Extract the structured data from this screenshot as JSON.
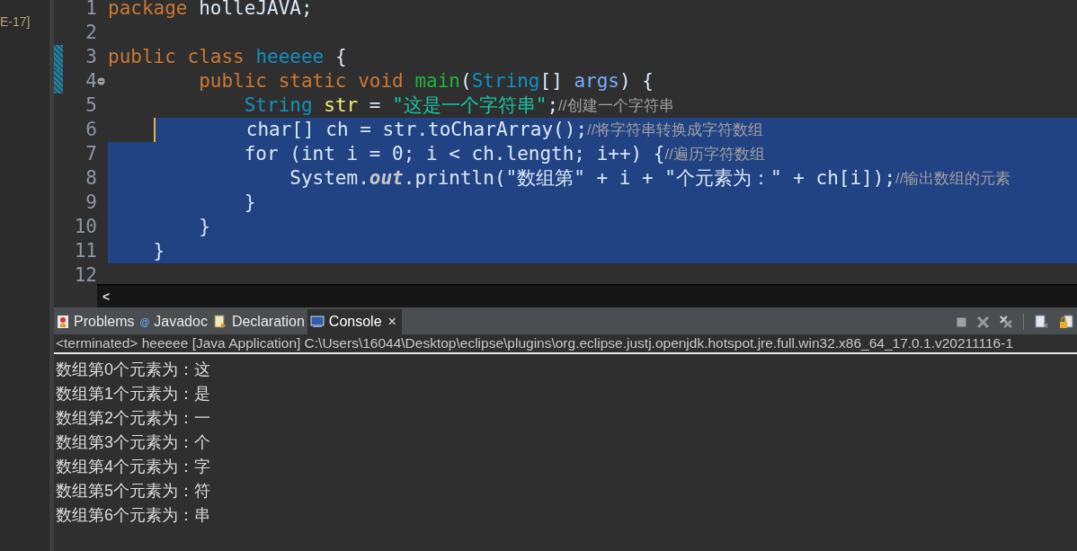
{
  "side_label": "E-17]",
  "editor": {
    "lines": [
      {
        "number": "1",
        "selected": false,
        "changed": false,
        "tokens": [
          {
            "kind": "keyword",
            "text": "package "
          },
          {
            "kind": "plain",
            "text": "holleJAVA;"
          }
        ]
      },
      {
        "number": "2",
        "selected": false,
        "changed": false
      },
      {
        "number": "3",
        "selected": false,
        "changed": true,
        "tokens": [
          {
            "kind": "keyword",
            "text": "public class "
          },
          {
            "kind": "type",
            "text": "heeeee"
          },
          {
            "kind": "plain",
            "text": " {"
          }
        ]
      },
      {
        "number": "4",
        "selected": false,
        "changed": true,
        "fold": true,
        "tokens": [
          {
            "kind": "keyword",
            "text": "\t\tpublic static void "
          },
          {
            "kind": "method",
            "text": "main"
          },
          {
            "kind": "plain",
            "text": "("
          },
          {
            "kind": "type",
            "text": "String"
          },
          {
            "kind": "plain",
            "text": "[] "
          },
          {
            "kind": "param",
            "text": "args"
          },
          {
            "kind": "plain",
            "text": ") {"
          }
        ]
      },
      {
        "number": "5",
        "selected": false,
        "changed": false,
        "tokens": [
          {
            "kind": "type",
            "text": "\t\t\tString "
          },
          {
            "kind": "local",
            "text": "str"
          },
          {
            "kind": "plain",
            "text": " = "
          },
          {
            "kind": "string",
            "text": "\"这是一个字符串\""
          },
          {
            "kind": "plain",
            "text": ";"
          },
          {
            "kind": "comment",
            "text": "//创建一个字符串"
          }
        ]
      },
      {
        "number": "6",
        "selected": true,
        "changed": false,
        "cursor": true,
        "tokens": [
          {
            "kind": "plain",
            "text": "\t\t\tchar[] ch = str.toCharArray();"
          },
          {
            "kind": "comment",
            "text": "//将字符串转换成字符数组"
          }
        ]
      },
      {
        "number": "7",
        "selected": true,
        "changed": false,
        "tokens": [
          {
            "kind": "plain",
            "text": "\t\t\tfor (int i = 0; i < ch.length; i++) {"
          },
          {
            "kind": "comment",
            "text": "//遍历字符数组"
          }
        ]
      },
      {
        "number": "8",
        "selected": true,
        "changed": false,
        "tokens": [
          {
            "kind": "plain",
            "text": "\t\t\t\tSystem."
          },
          {
            "kind": "static",
            "text": "out"
          },
          {
            "kind": "plain",
            "text": ".println(\"数组第\" + i + \"个元素为：\" + ch[i]);"
          },
          {
            "kind": "comment",
            "text": "//输出数组的元素"
          }
        ]
      },
      {
        "number": "9",
        "selected": true,
        "changed": false,
        "tokens": [
          {
            "kind": "plain",
            "text": "\t\t\t}"
          }
        ]
      },
      {
        "number": "10",
        "selected": true,
        "changed": false,
        "tokens": [
          {
            "kind": "plain",
            "text": "\t\t}"
          }
        ]
      },
      {
        "number": "11",
        "selected": true,
        "changed": false,
        "tokens": [
          {
            "kind": "plain",
            "text": "\t}"
          }
        ]
      },
      {
        "number": "12",
        "selected": false,
        "changed": false
      }
    ],
    "scroll_arrow": "<"
  },
  "panel": {
    "tabs": [
      {
        "label": "Problems",
        "selected": false
      },
      {
        "label": "Javadoc",
        "symbol": "@",
        "selected": false
      },
      {
        "label": "Declaration",
        "selected": false
      },
      {
        "label": "Console",
        "selected": true,
        "close": "×"
      }
    ],
    "description": "<terminated> heeeee [Java Application] C:\\Users\\16044\\Desktop\\eclipse\\plugins\\org.eclipse.justj.openjdk.hotspot.jre.full.win32.x86_64_17.0.1.v20211116-1",
    "output": [
      "数组第0个元素为：这",
      "数组第1个元素为：是",
      "数组第2个元素为：一",
      "数组第3个元素为：个",
      "数组第4个元素为：字",
      "数组第5个元素为：符",
      "数组第6个元素为：串"
    ]
  }
}
